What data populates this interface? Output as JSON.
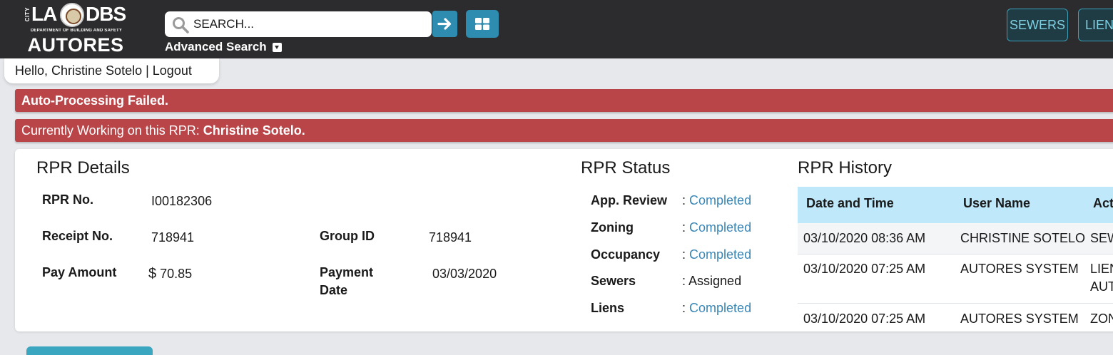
{
  "header": {
    "logo": {
      "city": "CITY",
      "la": "LA",
      "dbs": "DBS",
      "subtitle": "DEPARTMENT OF BUILDING AND SAFETY",
      "app_name": "AUTORES"
    },
    "search": {
      "placeholder": "SEARCH...",
      "value": ""
    },
    "advanced_search_label": "Advanced Search",
    "nav_buttons": [
      "SEWERS",
      "LIENS"
    ],
    "accent_color": "#2e8cb0"
  },
  "greeting": {
    "prefix": "Hello, Christine Sotelo",
    "separator": " | ",
    "logout": "Logout"
  },
  "alerts": {
    "failed": "Auto-Processing Failed.",
    "working_prefix": "Currently Working on this RPR: ",
    "working_user": "Christine Sotelo.",
    "color": "#b94548"
  },
  "rpr_details": {
    "title": "RPR Details",
    "rpr_no_label": "RPR No.",
    "rpr_no": "I00182306",
    "receipt_label": "Receipt No.",
    "receipt_no": "718941",
    "group_label": "Group ID",
    "group_id": "718941",
    "pay_label": "Pay Amount",
    "pay_currency": "$",
    "pay_amount": "70.85",
    "payment_date_label_1": "Payment",
    "payment_date_label_2": "Date",
    "payment_date": "03/03/2020"
  },
  "rpr_status": {
    "title": "RPR Status",
    "items": [
      {
        "label": "App. Review",
        "value": "Completed",
        "linked": true
      },
      {
        "label": "Zoning",
        "value": "Completed",
        "linked": true
      },
      {
        "label": "Occupancy",
        "value": "Completed",
        "linked": true
      },
      {
        "label": "Sewers",
        "value": "Assigned",
        "linked": false
      },
      {
        "label": "Liens",
        "value": "Completed",
        "linked": true
      }
    ],
    "separator": ":"
  },
  "rpr_history": {
    "title": "RPR History",
    "columns": [
      "Date and Time",
      "User Name",
      "Act"
    ],
    "rows": [
      {
        "date": "03/10/2020 08:36 AM",
        "user": "CHRISTINE SOTELO",
        "action_1": "SEW",
        "action_2": ""
      },
      {
        "date": "03/10/2020 07:25 AM",
        "user": "AUTORES SYSTEM",
        "action_1": "LIEN",
        "action_2": "AUT"
      },
      {
        "date": "03/10/2020 07:25 AM",
        "user": "AUTORES SYSTEM",
        "action_1": "ZON",
        "action_2": ""
      }
    ]
  }
}
